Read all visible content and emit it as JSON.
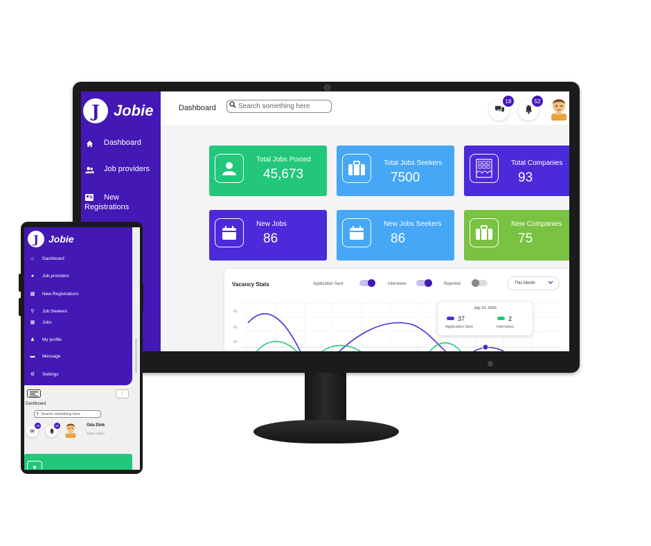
{
  "desktop": {
    "brand": {
      "logo_letter": "J",
      "name": "Jobie"
    },
    "sidebar": {
      "items": [
        {
          "label": "Dashboard",
          "icon": "home-icon"
        },
        {
          "label": "Job providers",
          "icon": "users-icon"
        },
        {
          "label": "New\nRegistrations",
          "icon": "id-card-icon"
        }
      ]
    },
    "header": {
      "title": "Dashboard",
      "search_placeholder": "Search something here",
      "messages_count": "18",
      "notifications_count": "52"
    },
    "cards": [
      {
        "label": "Total Jobs Posted",
        "value": "45,673",
        "color": "#22c77b",
        "icon": "user-icon"
      },
      {
        "label": "Total Jobs Seekers",
        "value": "7500",
        "color": "#45a7f5",
        "icon": "briefcase-icon"
      },
      {
        "label": "Total Companies",
        "value": "93",
        "color": "#4b2ad9",
        "icon": "building-icon"
      },
      {
        "label": "New Jobs",
        "value": "86",
        "color": "#4b2ad9",
        "icon": "calendar-icon"
      },
      {
        "label": "New Jobs Seekers",
        "value": "86",
        "color": "#45a7f5",
        "icon": "calendar-icon"
      },
      {
        "label": "New Companies",
        "value": "75",
        "color": "#7ac241",
        "icon": "briefcase-icon"
      }
    ],
    "vacancy": {
      "title": "Vacancy Stats",
      "toggles": [
        {
          "label": "Application Sent",
          "on": true
        },
        {
          "label": "Interviews",
          "on": true
        },
        {
          "label": "Rejected",
          "on": false
        }
      ],
      "period": "This Month",
      "tooltip": {
        "date": "July 23, 2020",
        "application_value": "37",
        "application_label": "Application Sent",
        "interviews_value": "2",
        "interviews_label": "Interviews"
      },
      "chart_data": {
        "type": "line",
        "ylim": [
          40,
          70
        ],
        "yticks": [
          "80",
          "60",
          "40"
        ],
        "series": [
          {
            "name": "Application Sent",
            "color": "#4b2ad9"
          },
          {
            "name": "Interviews",
            "color": "#22c77b"
          }
        ]
      }
    }
  },
  "mobile": {
    "brand": {
      "logo_letter": "J",
      "name": "Jobie"
    },
    "sidebar": {
      "items": [
        {
          "label": "Dashboard",
          "icon": "home-icon"
        },
        {
          "label": "Job providers",
          "icon": "users-icon"
        },
        {
          "label": "New Registrations",
          "icon": "id-card-icon"
        },
        {
          "label": "Job Seekers",
          "icon": "search-icon"
        },
        {
          "label": "Jobs",
          "icon": "grid-icon"
        },
        {
          "label": "My profile",
          "icon": "person-icon"
        },
        {
          "label": "Message",
          "icon": "chat-icon"
        },
        {
          "label": "Settings",
          "icon": "gear-icon"
        }
      ]
    },
    "page_title": "Dashboard",
    "search_placeholder": "Search something here",
    "messages_count": "18",
    "notifications_count": "52",
    "user_name": "Oda Dink",
    "user_role": "Super Admin"
  }
}
